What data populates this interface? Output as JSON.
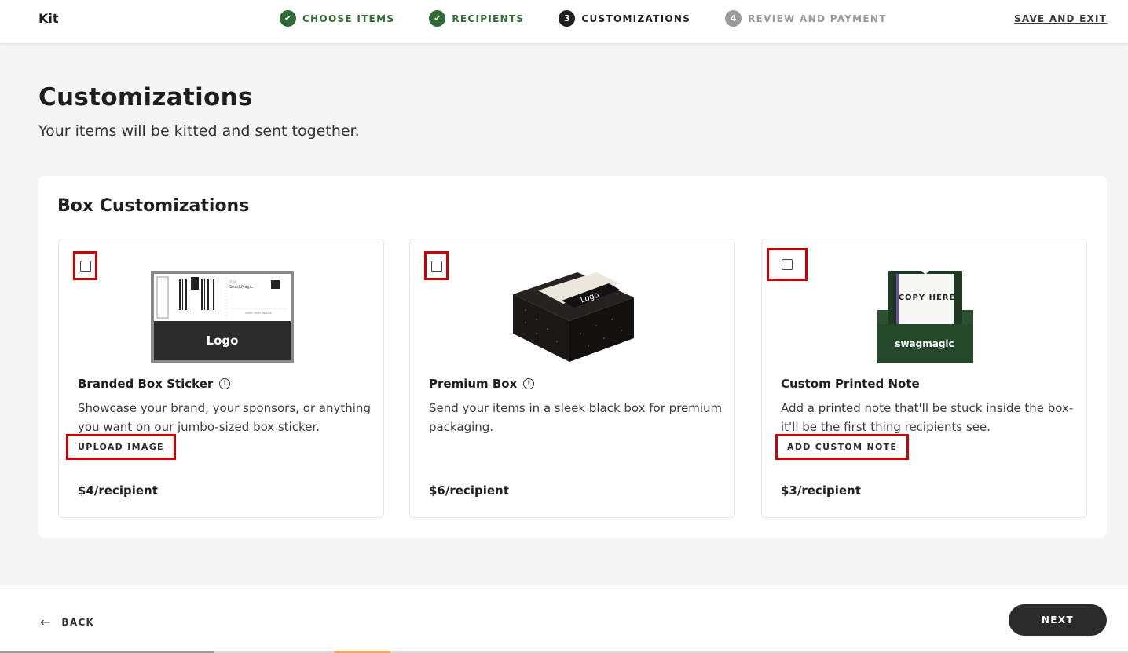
{
  "header": {
    "app_title": "Kit",
    "steps": [
      {
        "label": "CHOOSE ITEMS",
        "badge": "✔",
        "state": "done"
      },
      {
        "label": "RECIPIENTS",
        "badge": "✔",
        "state": "done"
      },
      {
        "label": "CUSTOMIZATIONS",
        "badge": "3",
        "state": "current"
      },
      {
        "label": "REVIEW AND PAYMENT",
        "badge": "4",
        "state": "upcoming"
      }
    ],
    "save_exit": "SAVE AND EXIT"
  },
  "page": {
    "title": "Customizations",
    "subtitle": "Your items will be kitted and sent together."
  },
  "section": {
    "title": "Box Customizations",
    "cards": [
      {
        "name": "Branded Box Sticker",
        "has_info": true,
        "description": "Showcase your brand, your sponsors, or anything you want on our jumbo-sized box sticker.",
        "action": "UPLOAD IMAGE",
        "price": "$4/recipient",
        "image_text": {
          "logo": "Logo",
          "brand": "SnackMagic",
          "title": "TITLE",
          "caption": "ENJOY YOUR SNACKS"
        }
      },
      {
        "name": "Premium Box",
        "has_info": true,
        "description": "Send your items in a sleek black box for premium packaging.",
        "action": "",
        "price": "$6/recipient",
        "image_text": {
          "logo": "Logo"
        }
      },
      {
        "name": "Custom Printed Note",
        "has_info": false,
        "description": "Add a printed note that'll be stuck inside the box- it'll be the first thing recipients see.",
        "action": "ADD CUSTOM NOTE",
        "price": "$3/recipient",
        "image_text": {
          "note": "COPY HERE",
          "brand": "swagmagic"
        }
      }
    ]
  },
  "footer": {
    "back": "BACK",
    "next": "NEXT"
  },
  "colors": {
    "done": "#2e6b35",
    "current": "#1f1f1f",
    "upcoming": "#9a9a9a",
    "highlight": "#cc0000",
    "next_bg": "#2a2a2a"
  },
  "icons": {
    "back": "arrow-left-icon",
    "info": "info-icon",
    "done_step": "check-icon"
  }
}
